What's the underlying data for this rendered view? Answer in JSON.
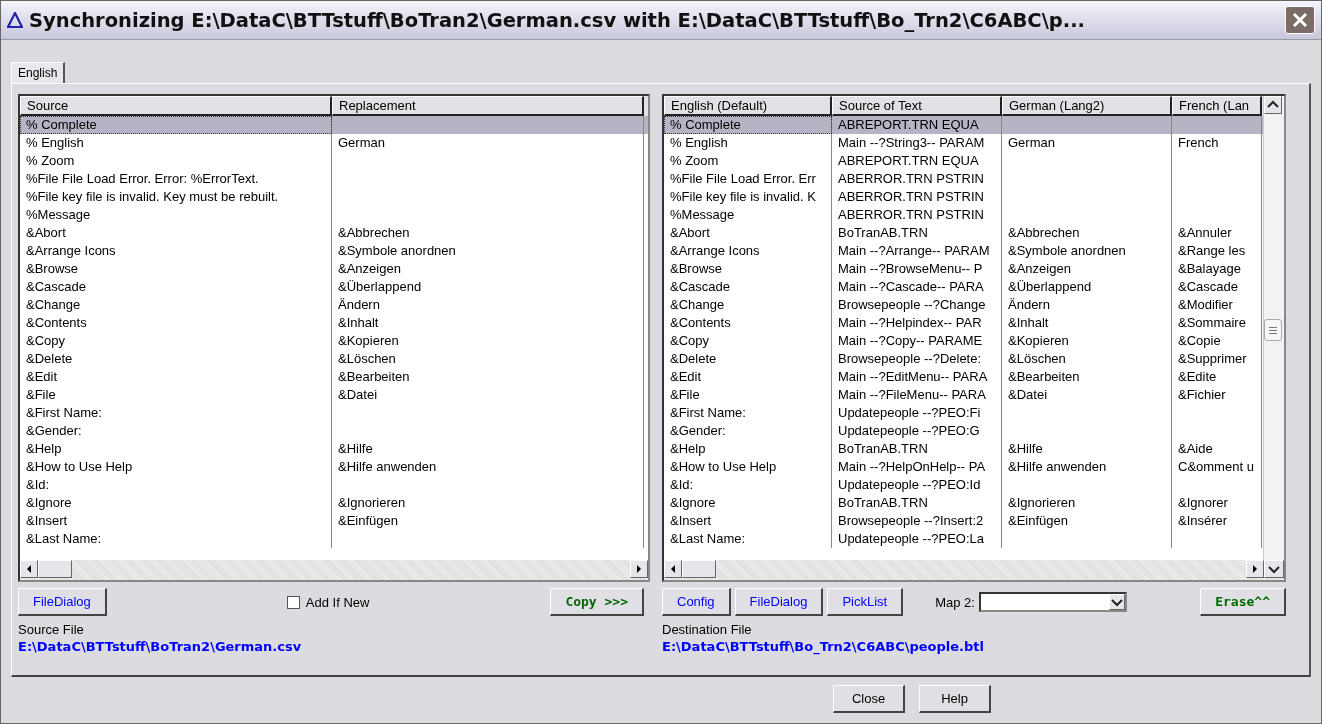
{
  "window": {
    "title": "Synchronizing E:\\DataC\\BTTstuff\\BoTran2\\German.csv with E:\\DataC\\BTTstuff\\Bo_Trn2\\C6ABC\\p..."
  },
  "tabs": [
    {
      "label": "English",
      "selected": true
    }
  ],
  "source_table": {
    "columns": [
      "Source",
      "Replacement"
    ],
    "rows": [
      {
        "cells": [
          "% Complete",
          ""
        ],
        "selected": true
      },
      {
        "cells": [
          "% English",
          "German"
        ],
        "selected": false
      },
      {
        "cells": [
          "% Zoom",
          ""
        ],
        "selected": false
      },
      {
        "cells": [
          "%File File Load Error.  Error: %ErrorText.",
          ""
        ],
        "selected": false
      },
      {
        "cells": [
          "%File key file is invalid. Key must be rebuilt.",
          ""
        ],
        "selected": false
      },
      {
        "cells": [
          "%Message",
          ""
        ],
        "selected": false
      },
      {
        "cells": [
          "&Abort",
          "&Abbrechen"
        ],
        "selected": false
      },
      {
        "cells": [
          "&Arrange Icons",
          "&Symbole anordnen"
        ],
        "selected": false
      },
      {
        "cells": [
          "&Browse",
          "&Anzeigen"
        ],
        "selected": false
      },
      {
        "cells": [
          "&Cascade",
          "&Überlappend"
        ],
        "selected": false
      },
      {
        "cells": [
          "&Change",
          "Ändern"
        ],
        "selected": false
      },
      {
        "cells": [
          "&Contents",
          "&Inhalt"
        ],
        "selected": false
      },
      {
        "cells": [
          "&Copy",
          "&Kopieren"
        ],
        "selected": false
      },
      {
        "cells": [
          "&Delete",
          "&Löschen"
        ],
        "selected": false
      },
      {
        "cells": [
          "&Edit",
          "&Bearbeiten"
        ],
        "selected": false
      },
      {
        "cells": [
          "&File",
          "&Datei"
        ],
        "selected": false
      },
      {
        "cells": [
          "&First Name:",
          ""
        ],
        "selected": false
      },
      {
        "cells": [
          "&Gender:",
          ""
        ],
        "selected": false
      },
      {
        "cells": [
          "&Help",
          "&Hilfe"
        ],
        "selected": false
      },
      {
        "cells": [
          "&How to Use Help",
          "&Hilfe anwenden"
        ],
        "selected": false
      },
      {
        "cells": [
          "&Id:",
          ""
        ],
        "selected": false
      },
      {
        "cells": [
          "&Ignore",
          "&Ignorieren"
        ],
        "selected": false
      },
      {
        "cells": [
          "&Insert",
          "&Einfügen"
        ],
        "selected": false
      },
      {
        "cells": [
          "&Last Name:",
          ""
        ],
        "selected": false
      }
    ]
  },
  "dest_table": {
    "columns": [
      "English (Default)",
      "Source of Text",
      "German (Lang2)",
      "French (Lan"
    ],
    "rows": [
      {
        "cells": [
          "% Complete",
          "ABREPORT.TRN EQUA",
          "",
          ""
        ],
        "selected": true
      },
      {
        "cells": [
          "% English",
          "Main --?String3-- PARAM",
          "German",
          "French"
        ],
        "selected": false
      },
      {
        "cells": [
          "% Zoom",
          "ABREPORT.TRN EQUA",
          "",
          ""
        ],
        "selected": false
      },
      {
        "cells": [
          "%File File Load Error.  Err",
          "ABERROR.TRN PSTRIN",
          "",
          ""
        ],
        "selected": false
      },
      {
        "cells": [
          "%File key file is invalid. K",
          "ABERROR.TRN PSTRIN",
          "",
          ""
        ],
        "selected": false
      },
      {
        "cells": [
          "%Message",
          "ABERROR.TRN PSTRIN",
          "",
          ""
        ],
        "selected": false
      },
      {
        "cells": [
          "&Abort",
          "BoTranAB.TRN",
          "&Abbrechen",
          "&Annuler"
        ],
        "selected": false
      },
      {
        "cells": [
          "&Arrange Icons",
          "Main --?Arrange-- PARAM",
          "&Symbole anordnen",
          "&Range les"
        ],
        "selected": false
      },
      {
        "cells": [
          "&Browse",
          "Main --?BrowseMenu-- P",
          "&Anzeigen",
          "&Balayage"
        ],
        "selected": false
      },
      {
        "cells": [
          "&Cascade",
          "Main --?Cascade-- PARA",
          "&Überlappend",
          "&Cascade"
        ],
        "selected": false
      },
      {
        "cells": [
          "&Change",
          "Browsepeople --?Change",
          "Ändern",
          "&Modifier"
        ],
        "selected": false
      },
      {
        "cells": [
          "&Contents",
          "Main --?Helpindex-- PAR",
          "&Inhalt",
          "&Sommaire"
        ],
        "selected": false
      },
      {
        "cells": [
          "&Copy",
          "Main --?Copy-- PARAME",
          "&Kopieren",
          "&Copie"
        ],
        "selected": false
      },
      {
        "cells": [
          "&Delete",
          "Browsepeople --?Delete:",
          "&Löschen",
          "&Supprimer"
        ],
        "selected": false
      },
      {
        "cells": [
          "&Edit",
          "Main --?EditMenu-- PARA",
          "&Bearbeiten",
          "&Edite"
        ],
        "selected": false
      },
      {
        "cells": [
          "&File",
          "Main --?FileMenu-- PARA",
          "&Datei",
          "&Fichier"
        ],
        "selected": false
      },
      {
        "cells": [
          "&First Name:",
          "Updatepeople --?PEO:Fi",
          "",
          ""
        ],
        "selected": false
      },
      {
        "cells": [
          "&Gender:",
          "Updatepeople --?PEO:G",
          "",
          ""
        ],
        "selected": false
      },
      {
        "cells": [
          "&Help",
          "BoTranAB.TRN",
          "&Hilfe",
          "&Aide"
        ],
        "selected": false
      },
      {
        "cells": [
          "&How to Use Help",
          "Main --?HelpOnHelp-- PA",
          "&Hilfe anwenden",
          "C&omment u"
        ],
        "selected": false
      },
      {
        "cells": [
          "&Id:",
          "Updatepeople --?PEO:Id",
          "",
          ""
        ],
        "selected": false
      },
      {
        "cells": [
          "&Ignore",
          "BoTranAB.TRN",
          "&Ignorieren",
          "&Ignorer"
        ],
        "selected": false
      },
      {
        "cells": [
          "&Insert",
          "Browsepeople --?Insert:2",
          "&Einfügen",
          "&Insérer"
        ],
        "selected": false
      },
      {
        "cells": [
          "&Last Name:",
          "Updatepeople --?PEO:La",
          "",
          ""
        ],
        "selected": false
      }
    ]
  },
  "source_controls": {
    "file_dialog": "FileDialog",
    "add_if_new": {
      "label": "Add If New",
      "checked": false
    },
    "copy": "Copy >>>",
    "file_label": "Source File",
    "file_path": "E:\\DataC\\BTTstuff\\BoTran2\\German.csv"
  },
  "dest_controls": {
    "buttons": [
      "Config",
      "FileDialog",
      "PickList"
    ],
    "map_label": "Map 2:",
    "erase": "Erase^^",
    "file_label": "Destination File",
    "file_path": "E:\\DataC\\BTTstuff\\Bo_Trn2\\C6ABC\\people.btl"
  },
  "buttons": [
    "Close",
    "Help"
  ]
}
